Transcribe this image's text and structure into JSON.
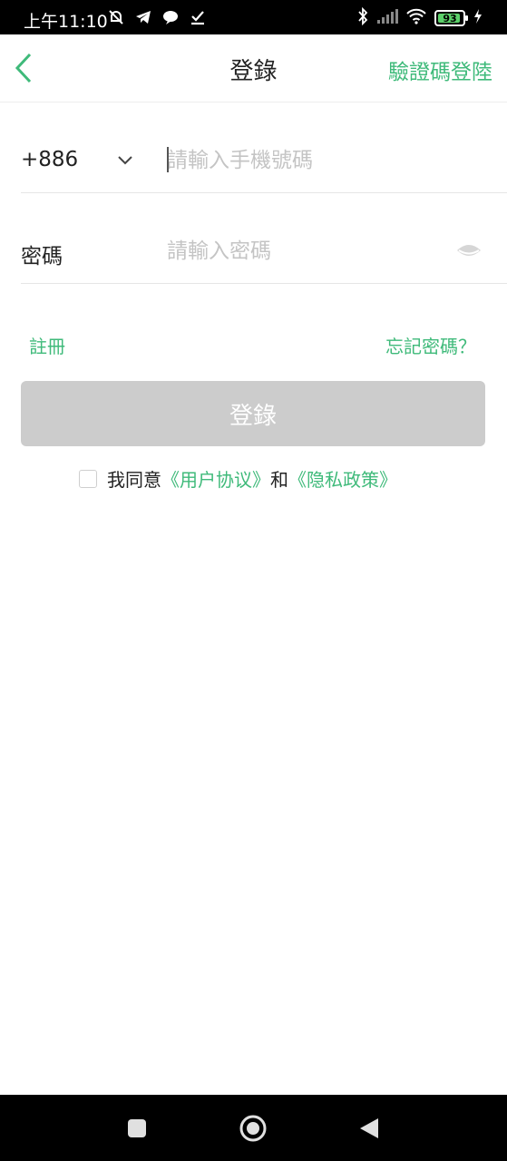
{
  "status_bar": {
    "time": "上午11:10",
    "battery": "93",
    "battery_level": 0.93,
    "left_icons": [
      "muted-alarm-icon",
      "telegram-icon",
      "chat-bubble-icon",
      "download-done-icon"
    ],
    "right_icons": [
      "bluetooth-icon",
      "signal-icon",
      "wifi-icon",
      "battery-icon",
      "charging-icon"
    ]
  },
  "header": {
    "back_icon": "chevron-left-icon",
    "title": "登錄",
    "action_label": "驗證碼登陸"
  },
  "phone": {
    "country_code": "+886",
    "dropdown_icon": "chevron-down-icon",
    "placeholder": "請輸入手機號碼",
    "value": ""
  },
  "password": {
    "label": "密碼",
    "placeholder": "請輸入密碼",
    "value": "",
    "toggle_icon": "eye-icon"
  },
  "links": {
    "register": "註冊",
    "forgot": "忘記密碼？"
  },
  "login_button": "登錄",
  "agreement": {
    "checked": false,
    "prefix": "我同意",
    "user_agreement": "《用户协议》",
    "and": "和",
    "privacy_policy": "《隐私政策》"
  },
  "colors": {
    "accent": "#3fba7a",
    "button_disabled": "#cccccc",
    "divider": "#e6e6e6"
  },
  "nav_bar": {
    "icons": [
      "recent-apps-icon",
      "home-icon",
      "back-icon"
    ]
  }
}
